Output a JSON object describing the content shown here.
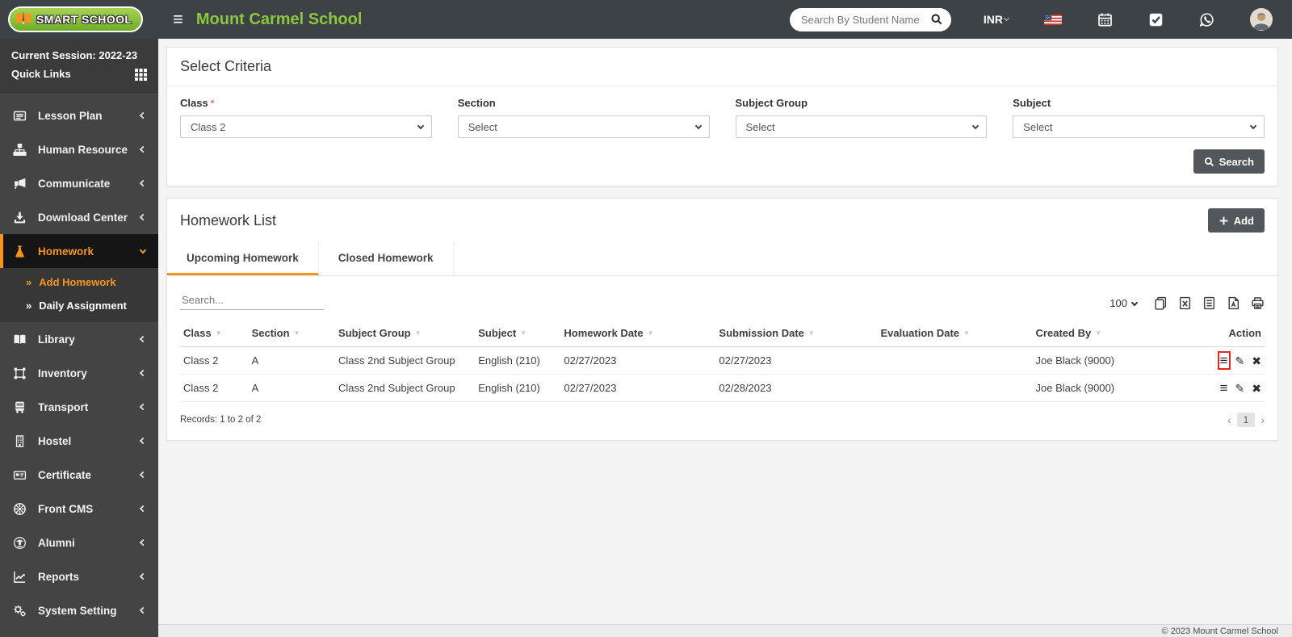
{
  "header": {
    "logo_text": "SMART SCHOOL",
    "school_name": "Mount Carmel School",
    "search_placeholder": "Search By Student Name",
    "currency": "INR",
    "icons": [
      "us-flag-icon",
      "calendar-icon",
      "task-check-icon",
      "whatsapp-icon",
      "avatar"
    ]
  },
  "sidebar": {
    "session_label": "Current Session: 2022-23",
    "quick_links_label": "Quick Links",
    "items": [
      {
        "label": "Lesson Plan",
        "icon": "lesson-plan"
      },
      {
        "label": "Human Resource",
        "icon": "human-resource"
      },
      {
        "label": "Communicate",
        "icon": "communicate"
      },
      {
        "label": "Download Center",
        "icon": "download-center"
      },
      {
        "label": "Homework",
        "icon": "homework",
        "active": true,
        "expanded": true,
        "children": [
          {
            "label": "Add Homework",
            "active": true
          },
          {
            "label": "Daily Assignment",
            "active": false
          }
        ]
      },
      {
        "label": "Library",
        "icon": "library"
      },
      {
        "label": "Inventory",
        "icon": "inventory"
      },
      {
        "label": "Transport",
        "icon": "transport"
      },
      {
        "label": "Hostel",
        "icon": "hostel"
      },
      {
        "label": "Certificate",
        "icon": "certificate"
      },
      {
        "label": "Front CMS",
        "icon": "front-cms"
      },
      {
        "label": "Alumni",
        "icon": "alumni"
      },
      {
        "label": "Reports",
        "icon": "reports"
      },
      {
        "label": "System Setting",
        "icon": "system-setting"
      }
    ]
  },
  "criteria": {
    "title": "Select Criteria",
    "fields": [
      {
        "label": "Class",
        "required": true,
        "value": "Class 2"
      },
      {
        "label": "Section",
        "required": false,
        "value": "Select"
      },
      {
        "label": "Subject Group",
        "required": false,
        "value": "Select"
      },
      {
        "label": "Subject",
        "required": false,
        "value": "Select"
      }
    ],
    "search_button": "Search"
  },
  "homework": {
    "title": "Homework List",
    "add_button": "Add",
    "tabs": [
      {
        "label": "Upcoming Homework",
        "active": true
      },
      {
        "label": "Closed Homework",
        "active": false
      }
    ],
    "search_placeholder": "Search...",
    "page_size": "100",
    "export_icons": [
      "copy",
      "excel",
      "csv",
      "pdf",
      "print"
    ],
    "table": {
      "columns": [
        {
          "key": "class_name",
          "label": "Class",
          "sortable": true
        },
        {
          "key": "section",
          "label": "Section",
          "sortable": true
        },
        {
          "key": "subject_group",
          "label": "Subject Group",
          "sortable": true
        },
        {
          "key": "subject",
          "label": "Subject",
          "sortable": true
        },
        {
          "key": "homework_date",
          "label": "Homework Date",
          "sortable": true
        },
        {
          "key": "submission_date",
          "label": "Submission Date",
          "sortable": true
        },
        {
          "key": "evaluation_date",
          "label": "Evaluation Date",
          "sortable": true
        },
        {
          "key": "created_by",
          "label": "Created By",
          "sortable": true
        },
        {
          "key": "action",
          "label": "Action",
          "sortable": false
        }
      ],
      "rows": [
        {
          "class_name": "Class 2",
          "section": "A",
          "subject_group": "Class 2nd Subject Group",
          "subject": "English (210)",
          "homework_date": "02/27/2023",
          "submission_date": "02/27/2023",
          "evaluation_date": "",
          "created_by": "Joe Black (9000)",
          "action_menu_highlighted": true
        },
        {
          "class_name": "Class 2",
          "section": "A",
          "subject_group": "Class 2nd Subject Group",
          "subject": "English (210)",
          "homework_date": "02/27/2023",
          "submission_date": "02/28/2023",
          "evaluation_date": "",
          "created_by": "Joe Black (9000)",
          "action_menu_highlighted": false
        }
      ]
    },
    "records_text": "Records: 1 to 2 of 2",
    "pagination": {
      "current_page": "1"
    }
  },
  "footer": {
    "copyright": "© 2023 Mount Carmel School"
  },
  "colors": {
    "accent_orange": "#f7941d",
    "brand_green": "#8dc63f",
    "header_bg": "#3d4246",
    "sidebar_bg": "#444444",
    "button_gray": "#53575b",
    "highlight_red": "#e8251d"
  }
}
